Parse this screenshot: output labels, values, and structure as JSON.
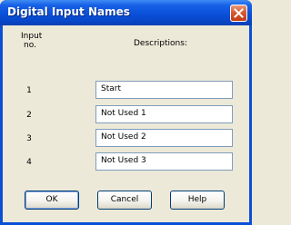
{
  "window": {
    "title": "Digital Input Names"
  },
  "icons": {
    "close": "close-x-icon"
  },
  "colors": {
    "title_bar": "#0A50D8",
    "close_button": "#D8532C",
    "dialog_bg": "#ECE9D8"
  },
  "headers": {
    "input_line1": "Input",
    "input_line2": "no.",
    "descriptions": "Descriptions:"
  },
  "rows": [
    {
      "num": "1",
      "value": "Start"
    },
    {
      "num": "2",
      "value": "Not Used 1"
    },
    {
      "num": "3",
      "value": "Not Used 2"
    },
    {
      "num": "4",
      "value": "Not Used 3"
    }
  ],
  "buttons": {
    "ok": "OK",
    "cancel": "Cancel",
    "help": "Help"
  }
}
